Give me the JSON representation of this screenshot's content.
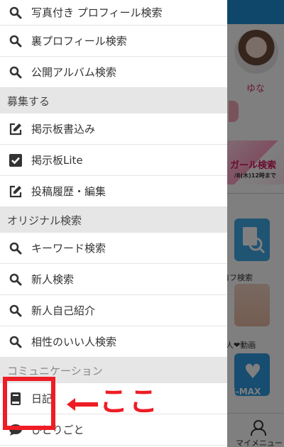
{
  "drawer": {
    "items_top": [
      {
        "label": "写真付き プロフィール検索",
        "icon": "search-icon"
      },
      {
        "label": "裏プロフィール検索",
        "icon": "search-icon"
      },
      {
        "label": "公開アルバム検索",
        "icon": "search-icon"
      }
    ],
    "sections": {
      "recruit": "募集する",
      "original": "オリジナル検索",
      "community": "コミュニケーション"
    },
    "recruit_items": [
      {
        "label": "掲示板書込み",
        "icon": "edit-icon"
      },
      {
        "label": "掲示板Lite",
        "icon": "checkbox-icon"
      },
      {
        "label": "投稿履歴・編集",
        "icon": "edit-icon"
      }
    ],
    "original_items": [
      {
        "label": "キーワード検索",
        "icon": "search-icon"
      },
      {
        "label": "新人検索",
        "icon": "search-icon"
      },
      {
        "label": "新人自己紹介",
        "icon": "search-icon"
      },
      {
        "label": "相性のいい人検索",
        "icon": "search-icon"
      }
    ],
    "community_items": [
      {
        "label": "日記",
        "icon": "book-icon"
      },
      {
        "label": "ひとりごと",
        "icon": "speech-bubble-icon"
      }
    ]
  },
  "annotation": {
    "callout": "ここ",
    "color": "#ee1c25"
  },
  "background": {
    "profile_name": "ゆな",
    "banner_text": "ガール検索",
    "banner_sub": "/8(木)12時まで",
    "tile_labels": [
      "ロフ検索",
      "人❤動画"
    ],
    "gmax": "G-MAX",
    "footer_label": "マイメニュー",
    "header_color": "#1e8fd6"
  }
}
